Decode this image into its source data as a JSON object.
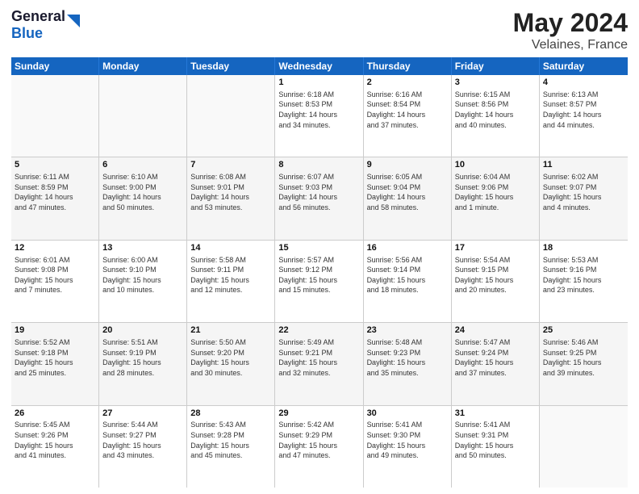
{
  "header": {
    "logo_line1": "General",
    "logo_line2": "Blue",
    "title": "May 2024",
    "location": "Velaines, France"
  },
  "weekdays": [
    "Sunday",
    "Monday",
    "Tuesday",
    "Wednesday",
    "Thursday",
    "Friday",
    "Saturday"
  ],
  "rows": [
    [
      {
        "day": "",
        "info": ""
      },
      {
        "day": "",
        "info": ""
      },
      {
        "day": "",
        "info": ""
      },
      {
        "day": "1",
        "info": "Sunrise: 6:18 AM\nSunset: 8:53 PM\nDaylight: 14 hours\nand 34 minutes."
      },
      {
        "day": "2",
        "info": "Sunrise: 6:16 AM\nSunset: 8:54 PM\nDaylight: 14 hours\nand 37 minutes."
      },
      {
        "day": "3",
        "info": "Sunrise: 6:15 AM\nSunset: 8:56 PM\nDaylight: 14 hours\nand 40 minutes."
      },
      {
        "day": "4",
        "info": "Sunrise: 6:13 AM\nSunset: 8:57 PM\nDaylight: 14 hours\nand 44 minutes."
      }
    ],
    [
      {
        "day": "5",
        "info": "Sunrise: 6:11 AM\nSunset: 8:59 PM\nDaylight: 14 hours\nand 47 minutes."
      },
      {
        "day": "6",
        "info": "Sunrise: 6:10 AM\nSunset: 9:00 PM\nDaylight: 14 hours\nand 50 minutes."
      },
      {
        "day": "7",
        "info": "Sunrise: 6:08 AM\nSunset: 9:01 PM\nDaylight: 14 hours\nand 53 minutes."
      },
      {
        "day": "8",
        "info": "Sunrise: 6:07 AM\nSunset: 9:03 PM\nDaylight: 14 hours\nand 56 minutes."
      },
      {
        "day": "9",
        "info": "Sunrise: 6:05 AM\nSunset: 9:04 PM\nDaylight: 14 hours\nand 58 minutes."
      },
      {
        "day": "10",
        "info": "Sunrise: 6:04 AM\nSunset: 9:06 PM\nDaylight: 15 hours\nand 1 minute."
      },
      {
        "day": "11",
        "info": "Sunrise: 6:02 AM\nSunset: 9:07 PM\nDaylight: 15 hours\nand 4 minutes."
      }
    ],
    [
      {
        "day": "12",
        "info": "Sunrise: 6:01 AM\nSunset: 9:08 PM\nDaylight: 15 hours\nand 7 minutes."
      },
      {
        "day": "13",
        "info": "Sunrise: 6:00 AM\nSunset: 9:10 PM\nDaylight: 15 hours\nand 10 minutes."
      },
      {
        "day": "14",
        "info": "Sunrise: 5:58 AM\nSunset: 9:11 PM\nDaylight: 15 hours\nand 12 minutes."
      },
      {
        "day": "15",
        "info": "Sunrise: 5:57 AM\nSunset: 9:12 PM\nDaylight: 15 hours\nand 15 minutes."
      },
      {
        "day": "16",
        "info": "Sunrise: 5:56 AM\nSunset: 9:14 PM\nDaylight: 15 hours\nand 18 minutes."
      },
      {
        "day": "17",
        "info": "Sunrise: 5:54 AM\nSunset: 9:15 PM\nDaylight: 15 hours\nand 20 minutes."
      },
      {
        "day": "18",
        "info": "Sunrise: 5:53 AM\nSunset: 9:16 PM\nDaylight: 15 hours\nand 23 minutes."
      }
    ],
    [
      {
        "day": "19",
        "info": "Sunrise: 5:52 AM\nSunset: 9:18 PM\nDaylight: 15 hours\nand 25 minutes."
      },
      {
        "day": "20",
        "info": "Sunrise: 5:51 AM\nSunset: 9:19 PM\nDaylight: 15 hours\nand 28 minutes."
      },
      {
        "day": "21",
        "info": "Sunrise: 5:50 AM\nSunset: 9:20 PM\nDaylight: 15 hours\nand 30 minutes."
      },
      {
        "day": "22",
        "info": "Sunrise: 5:49 AM\nSunset: 9:21 PM\nDaylight: 15 hours\nand 32 minutes."
      },
      {
        "day": "23",
        "info": "Sunrise: 5:48 AM\nSunset: 9:23 PM\nDaylight: 15 hours\nand 35 minutes."
      },
      {
        "day": "24",
        "info": "Sunrise: 5:47 AM\nSunset: 9:24 PM\nDaylight: 15 hours\nand 37 minutes."
      },
      {
        "day": "25",
        "info": "Sunrise: 5:46 AM\nSunset: 9:25 PM\nDaylight: 15 hours\nand 39 minutes."
      }
    ],
    [
      {
        "day": "26",
        "info": "Sunrise: 5:45 AM\nSunset: 9:26 PM\nDaylight: 15 hours\nand 41 minutes."
      },
      {
        "day": "27",
        "info": "Sunrise: 5:44 AM\nSunset: 9:27 PM\nDaylight: 15 hours\nand 43 minutes."
      },
      {
        "day": "28",
        "info": "Sunrise: 5:43 AM\nSunset: 9:28 PM\nDaylight: 15 hours\nand 45 minutes."
      },
      {
        "day": "29",
        "info": "Sunrise: 5:42 AM\nSunset: 9:29 PM\nDaylight: 15 hours\nand 47 minutes."
      },
      {
        "day": "30",
        "info": "Sunrise: 5:41 AM\nSunset: 9:30 PM\nDaylight: 15 hours\nand 49 minutes."
      },
      {
        "day": "31",
        "info": "Sunrise: 5:41 AM\nSunset: 9:31 PM\nDaylight: 15 hours\nand 50 minutes."
      },
      {
        "day": "",
        "info": ""
      }
    ]
  ]
}
